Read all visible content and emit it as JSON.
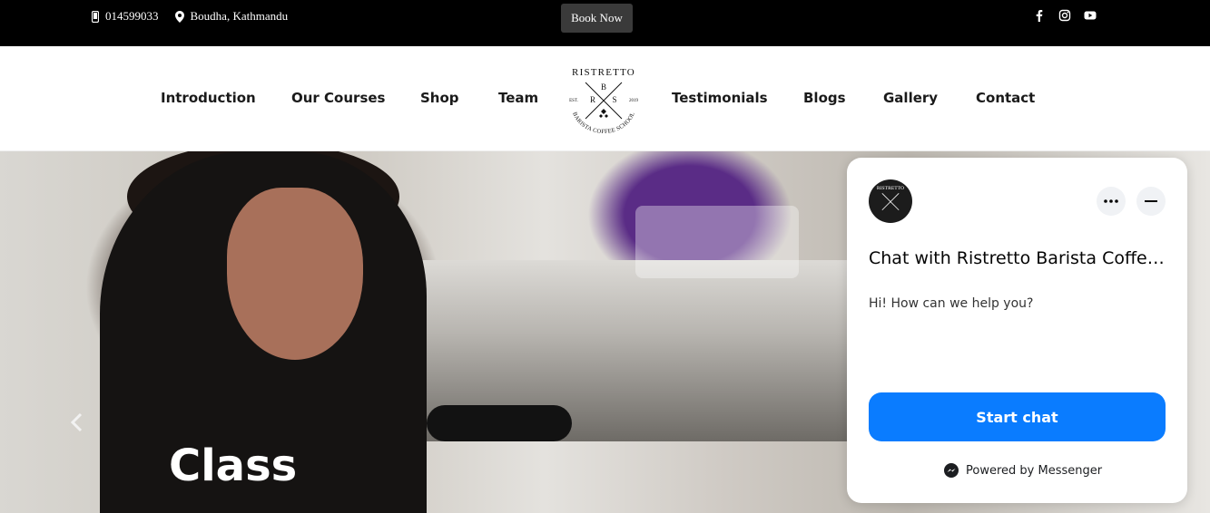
{
  "topbar": {
    "phone": "014599033",
    "phone_icon": "phone-icon",
    "location": "Boudha, Kathmandu",
    "location_icon": "map-pin-icon",
    "book_label": "Book Now",
    "social_icons": [
      "facebook-icon",
      "instagram-icon",
      "youtube-icon"
    ]
  },
  "nav": {
    "left": [
      "Introduction",
      "Our Courses",
      "Shop",
      "Team"
    ],
    "right": [
      "Testimonials",
      "Blogs",
      "Gallery",
      "Contact"
    ]
  },
  "logo": {
    "top_text": "RISTRETTO",
    "letters": [
      "B",
      "R",
      "S"
    ],
    "est": "EST.",
    "year": "2019",
    "bottom_text": "BARISTA COFFEE SCHOOL"
  },
  "hero": {
    "title": "Class",
    "prev_icon": "chevron-left-icon"
  },
  "chat": {
    "title": "Chat with Ristretto Barista Coffee ...",
    "greeting": "Hi! How can we help you?",
    "start_label": "Start chat",
    "powered_by": "Powered by Messenger",
    "accent": "#0a7cff"
  },
  "colors": {
    "topbar_bg": "#000000",
    "book_btn_bg": "#3a3a3a",
    "nav_text": "#1a1a1a"
  }
}
